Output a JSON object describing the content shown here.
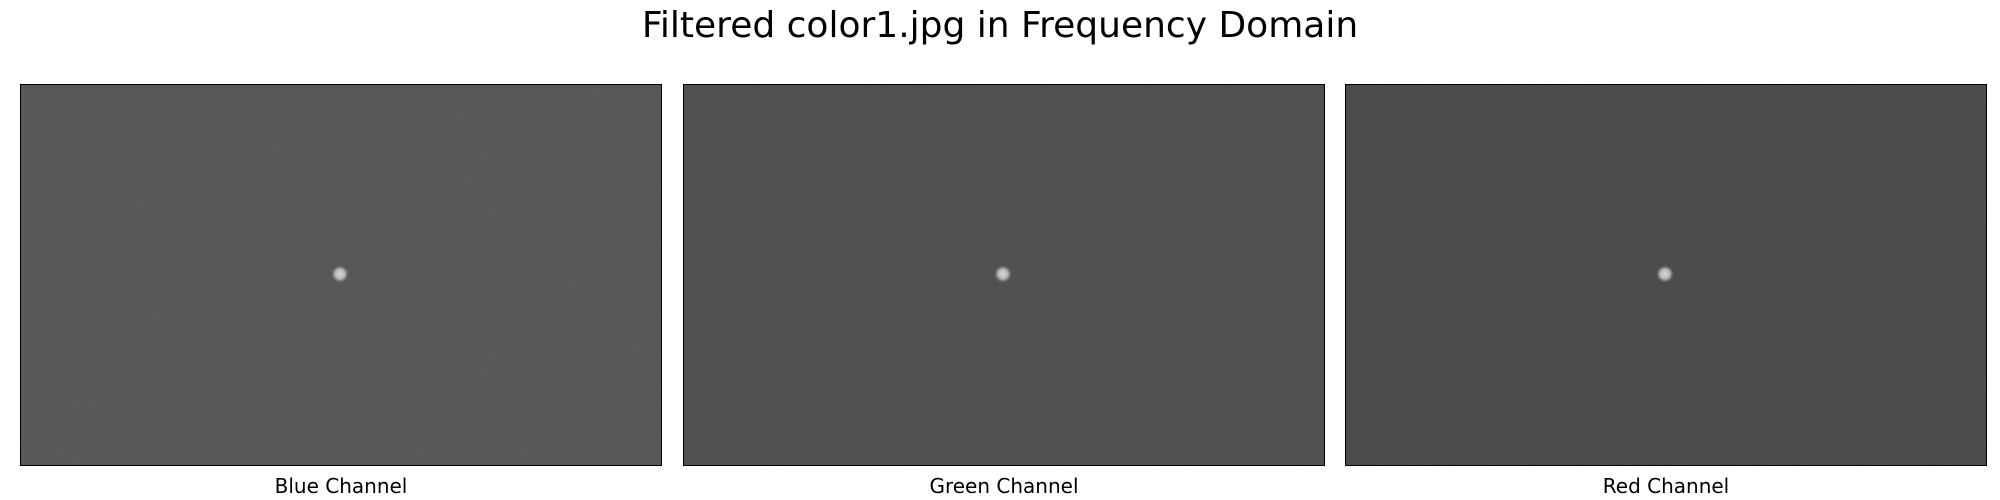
{
  "figure": {
    "title": "Filtered color1.jpg in Frequency Domain"
  },
  "panels": [
    {
      "label": "Blue Channel",
      "background_color": "#535353",
      "center_highlight_color": "#c8c8c8"
    },
    {
      "label": "Green Channel",
      "background_color": "#4b4b4b",
      "center_highlight_color": "#c8c8c8"
    },
    {
      "label": "Red Channel",
      "background_color": "#464646",
      "center_highlight_color": "#c8c8c8"
    }
  ]
}
